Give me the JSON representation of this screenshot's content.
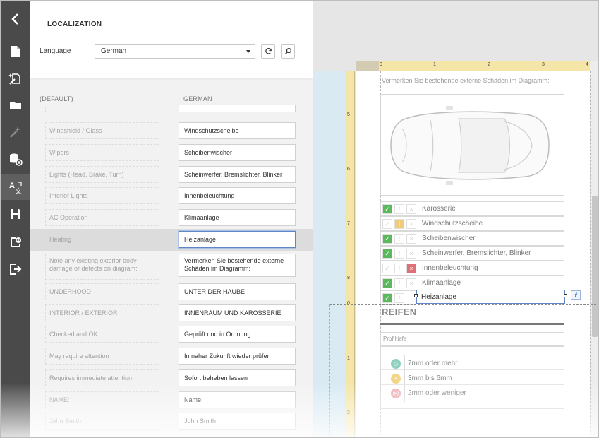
{
  "toolbar": {
    "items": [
      {
        "name": "back-icon"
      },
      {
        "name": "new-report-icon"
      },
      {
        "name": "wizard-icon"
      },
      {
        "name": "open-icon"
      },
      {
        "name": "magic-icon"
      },
      {
        "name": "add-datasource-icon"
      },
      {
        "name": "localization-icon"
      },
      {
        "name": "save-icon"
      },
      {
        "name": "preview-icon"
      },
      {
        "name": "exit-icon"
      }
    ],
    "active": "localization-icon"
  },
  "localization": {
    "title": "LOCALIZATION",
    "language_label": "Language",
    "language_value": "German",
    "col_default": "(DEFAULT)",
    "col_language": "GERMAN",
    "rows": [
      {
        "default": "Windshield / Glass",
        "value": "Windschutzscheibe"
      },
      {
        "default": "Wipers",
        "value": "Scheibenwischer"
      },
      {
        "default": "Lights (Head, Brake, Turn)",
        "value": "Scheinwerfer, Bremslichter, Blinker"
      },
      {
        "default": "Interior Lights",
        "value": "Innenbeleuchtung"
      },
      {
        "default": "AC Operation",
        "value": "Klimaanlage"
      },
      {
        "default": "Heating",
        "value": "Heizanlage"
      },
      {
        "default": "Note any existing exterior body damage or defects on diagram:",
        "value": "Vermerken Sie bestehende externe Schäden im Diagramm:"
      },
      {
        "default": "UNDERHOOD",
        "value": "UNTER DER HAUBE"
      },
      {
        "default": "INTERIOR / EXTERIOR",
        "value": "INNENRAUM UND KAROSSERIE"
      },
      {
        "default": "Checked and OK",
        "value": "Geprüft und in Ordnung"
      },
      {
        "default": "May require attention",
        "value": "In naher Zukunft wieder prüfen"
      },
      {
        "default": "Requires immediate attention",
        "value": "Sofort beheben lassen"
      },
      {
        "default": "NAME:",
        "value": "Name:"
      },
      {
        "default": "John Smith",
        "value": "John Smith"
      }
    ]
  },
  "report": {
    "note": "Vermerken Sie bestehende externe Schäden im Diagramm:",
    "ruler_top": [
      "0",
      "1",
      "2",
      "3",
      "4"
    ],
    "ruler_left": [
      "5",
      "6",
      "7",
      "8",
      "0",
      "1",
      "2"
    ],
    "checklist": [
      {
        "label": "Karosserie",
        "state": "ok"
      },
      {
        "label": "Windschutzscheibe",
        "state": "warn"
      },
      {
        "label": "Scheibenwischer",
        "state": "ok"
      },
      {
        "label": "Scheinwerfer, Bremslichter, Blinker",
        "state": "ok"
      },
      {
        "label": "Innenbeleuchtung",
        "state": "bad"
      },
      {
        "label": "Klimaanlage",
        "state": "ok"
      },
      {
        "label": "Heizanlage",
        "state": "ok"
      }
    ],
    "section_title": "REIFEN",
    "tread_header": "Profiltiefe",
    "tread_rows": [
      {
        "label": "7mm oder mehr",
        "color": "#8fd0bf",
        "icon": "smile-icon"
      },
      {
        "label": "3mm bis 6mm",
        "color": "#f3d58a",
        "icon": "neutral-icon"
      },
      {
        "label": "2mm oder weniger",
        "color": "#efb1b8",
        "icon": "frown-icon"
      }
    ],
    "function_tag": "f"
  },
  "colors": {
    "ok": "#5cb85c",
    "warn": "#f0ad4e",
    "bad": "#d9534f",
    "focus": "#5f86c6"
  }
}
